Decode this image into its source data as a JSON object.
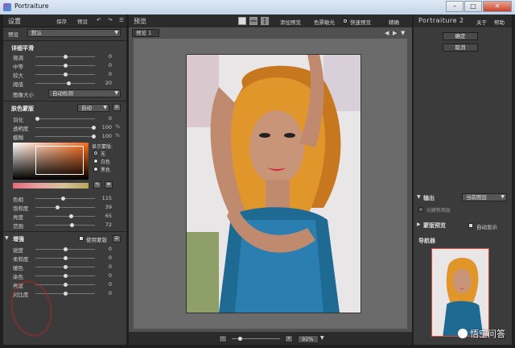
{
  "window": {
    "title": "Portraiture",
    "minimize": "–",
    "maximize": "□",
    "close": "✕"
  },
  "left": {
    "tabs": {
      "settings": "设置",
      "save": "保存",
      "preset": "预设"
    },
    "preset": {
      "label": "预设",
      "value": "默认"
    },
    "detail": {
      "title": "详细平滑",
      "sliders": [
        {
          "name": "微调",
          "value": "0",
          "pos": 0.5
        },
        {
          "name": "中等",
          "value": "0",
          "pos": 0.5
        },
        {
          "name": "较大",
          "value": "0",
          "pos": 0.5
        },
        {
          "name": "阈值",
          "value": "20",
          "pos": 0.55
        }
      ],
      "size_label": "图像大小",
      "size_value": "自动检测"
    },
    "mask": {
      "title": "肤色蒙版",
      "mode": "自动",
      "feather_label": "羽化",
      "feather_value": "0",
      "opacity_label": "透明度",
      "opacity_value": "100",
      "opacity_unit": "%",
      "blur_label": "模糊",
      "blur_value": "100",
      "blur_unit": "%",
      "display_label": "显示蒙版:",
      "radio": [
        "无",
        "白色",
        "黑色"
      ],
      "hsv": [
        {
          "name": "色相",
          "value": "115",
          "pos": 0.45
        },
        {
          "name": "饱和度",
          "value": "39",
          "pos": 0.35
        },
        {
          "name": "亮度",
          "value": "65",
          "pos": 0.6
        },
        {
          "name": "范围",
          "value": "72",
          "pos": 0.62
        }
      ]
    },
    "enhance": {
      "title": "增强",
      "use_mask_label": "使用蒙版",
      "sliders": [
        {
          "name": "锐度",
          "value": "0",
          "pos": 0.5
        },
        {
          "name": "柔和度",
          "value": "0",
          "pos": 0.5
        },
        {
          "name": "暖色",
          "value": "0",
          "pos": 0.5
        },
        {
          "name": "染色",
          "value": "0",
          "pos": 0.5
        },
        {
          "name": "亮度",
          "value": "0",
          "pos": 0.5
        },
        {
          "name": "对比度",
          "value": "0",
          "pos": 0.5
        }
      ]
    }
  },
  "center": {
    "title": "预览",
    "add_preview": "添加预览",
    "color_sample": "色票敏光",
    "fast_preview": "快速预览",
    "precise": "精确",
    "tab_label": "预览 1",
    "zoom": "92%"
  },
  "right": {
    "brand": "Portraiture 2",
    "about": "关于",
    "help": "帮助",
    "ok": "确定",
    "cancel": "取消",
    "output_label": "输出",
    "output_value": "当前图层",
    "create_layer": "创建新图层",
    "mask_preview_label": "蒙版预览",
    "auto_display": "自动显示",
    "navigator": "导航器"
  },
  "watermark": {
    "text": "悟空问答"
  },
  "colors": {
    "panel": "#3b3b3b",
    "dark": "#2b2b2b",
    "accent_orange": "#ff7a2a"
  }
}
